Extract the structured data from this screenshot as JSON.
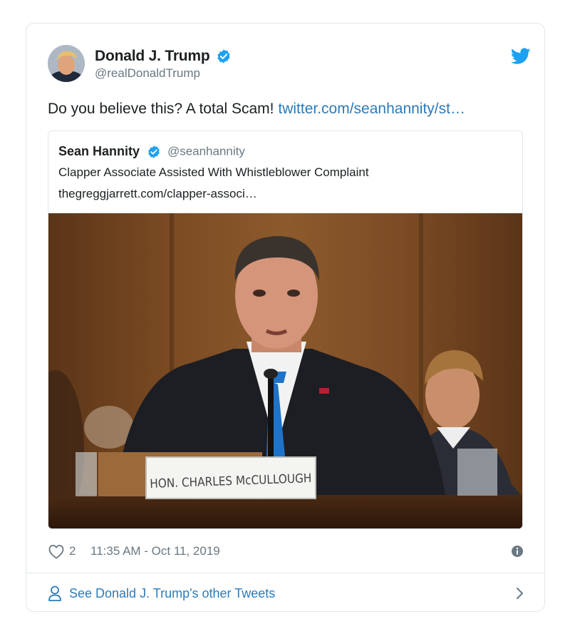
{
  "author": {
    "display_name": "Donald J. Trump",
    "handle": "@realDonaldTrump",
    "verified": true
  },
  "tweet": {
    "text": "Do you believe this?  A total Scam! ",
    "link_text": "twitter.com/seanhannity/st…"
  },
  "quoted_tweet": {
    "display_name": "Sean Hannity",
    "handle": "@seanhannity",
    "verified": true,
    "title": "Clapper Associate Assisted With Whistleblower Complaint",
    "url": "thegreggjarrett.com/clapper-associ…",
    "photo": {
      "nameplate": "HON. CHARLES McCULLOUGH"
    }
  },
  "meta": {
    "likes": "2",
    "timestamp": "11:35 AM - Oct 11, 2019"
  },
  "footer": {
    "label": "See Donald J. Trump's other Tweets"
  },
  "icons": {
    "verified": "verified-badge-icon",
    "twitter": "twitter-bird-icon",
    "like": "heart-icon",
    "info": "info-icon",
    "profile": "person-icon",
    "more": "chevron-right-icon"
  },
  "colors": {
    "link": "#2b7bb9",
    "verified": "#1da1f2",
    "secondary_text": "#697882",
    "border": "#e1e8ed"
  }
}
